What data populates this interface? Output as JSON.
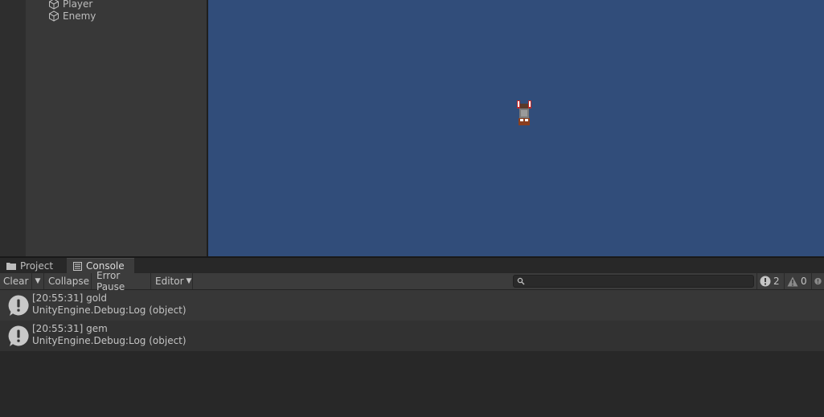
{
  "hierarchy": {
    "items": [
      {
        "label": "Player",
        "icon": "gameobject-cube-icon"
      },
      {
        "label": "Enemy",
        "icon": "gameobject-cube-icon"
      }
    ]
  },
  "scene": {
    "background": "#314d7a",
    "sprite": "player-character-sprite"
  },
  "tabs": [
    {
      "label": "Project",
      "icon": "folder-icon",
      "active": false
    },
    {
      "label": "Console",
      "icon": "console-icon",
      "active": true
    }
  ],
  "toolbar": {
    "clear_label": "Clear",
    "collapse_label": "Collapse",
    "error_pause_label": "Error Pause",
    "editor_label": "Editor",
    "search_placeholder": "",
    "info_count": "2",
    "warning_count": "0"
  },
  "logs": [
    {
      "line1": "[20:55:31] gold",
      "line2": "UnityEngine.Debug:Log (object)",
      "icon": "info-message-icon"
    },
    {
      "line1": "[20:55:31] gem",
      "line2": "UnityEngine.Debug:Log (object)",
      "icon": "info-message-icon"
    }
  ]
}
